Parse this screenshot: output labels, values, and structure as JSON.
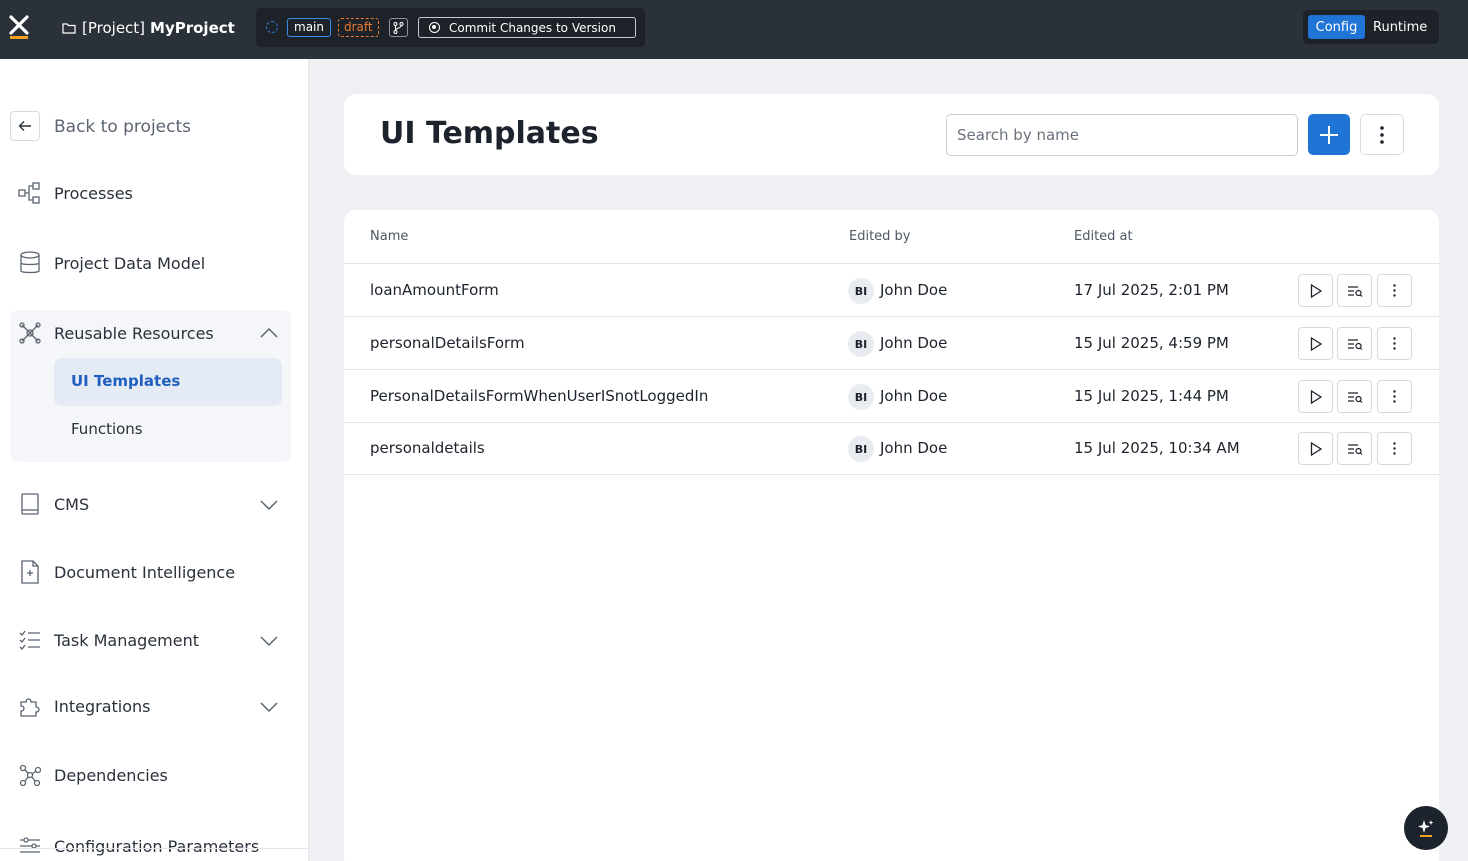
{
  "topbar": {
    "project_prefix": "[Project]",
    "project_name": "MyProject",
    "branch": "main",
    "status": "draft",
    "commit_label": "Commit Changes to Version",
    "mode_config": "Config",
    "mode_runtime": "Runtime"
  },
  "sidebar": {
    "back_label": "Back to projects",
    "items": {
      "processes": "Processes",
      "data_model": "Project Data Model",
      "reusable": "Reusable Resources",
      "ui_templates": "UI Templates",
      "functions": "Functions",
      "cms": "CMS",
      "doc_intel": "Document Intelligence",
      "task_mgmt": "Task Management",
      "integrations": "Integrations",
      "dependencies": "Dependencies",
      "config_params": "Configuration Parameters"
    }
  },
  "main": {
    "title": "UI Templates",
    "search_placeholder": "Search by name",
    "columns": {
      "name": "Name",
      "edited_by": "Edited by",
      "edited_at": "Edited at"
    },
    "rows": [
      {
        "name": "loanAmountForm",
        "initials": "BI",
        "user": "John Doe",
        "date": "17 Jul 2025, 2:01 PM"
      },
      {
        "name": "personalDetailsForm",
        "initials": "BI",
        "user": "John Doe",
        "date": "15 Jul 2025, 4:59 PM"
      },
      {
        "name": "PersonalDetailsFormWhenUserISnotLoggedIn",
        "initials": "BI",
        "user": "John Doe",
        "date": "15 Jul 2025, 1:44 PM"
      },
      {
        "name": "personaldetails",
        "initials": "BI",
        "user": "John Doe",
        "date": "15 Jul 2025, 10:34 AM"
      }
    ]
  },
  "colors": {
    "accent": "#1f74d6",
    "topbar": "#2b3139",
    "draft": "#e8792f",
    "logo_underline": "#f2a21e"
  }
}
